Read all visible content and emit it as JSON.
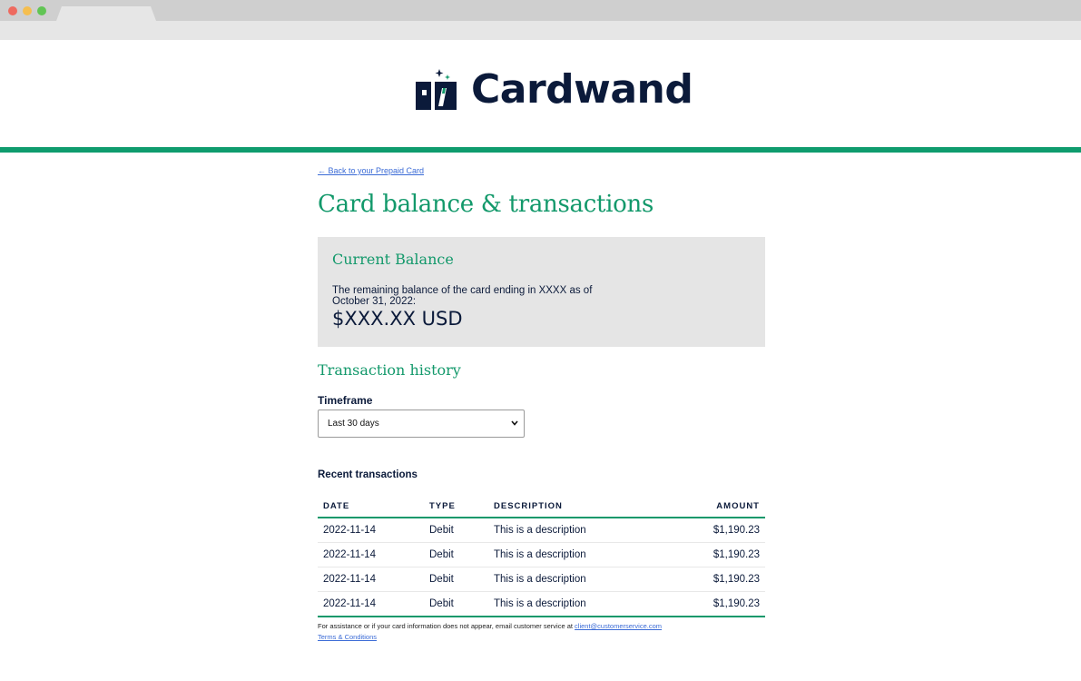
{
  "brand": {
    "name": "Cardwand",
    "colors": {
      "primary_green": "#13996b",
      "navy": "#0b1a3a",
      "link": "#3b6bd6",
      "card_bg": "#e5e5e5"
    }
  },
  "nav": {
    "back_link": "← Back to your Prepaid Card"
  },
  "page": {
    "title": "Card balance & transactions"
  },
  "balance": {
    "heading": "Current Balance",
    "description": "The remaining balance of the card ending in XXXX as of October 31, 2022:",
    "amount": "$XXX.XX USD"
  },
  "history": {
    "heading": "Transaction history",
    "timeframe_label": "Timeframe",
    "timeframe_selected": "Last 30 days",
    "recent_label": "Recent transactions",
    "columns": {
      "date": "DATE",
      "type": "TYPE",
      "description": "DESCRIPTION",
      "amount": "AMOUNT"
    },
    "rows": [
      {
        "date": "2022-11-14",
        "type": "Debit",
        "description": "This is a description",
        "amount": "$1,190.23"
      },
      {
        "date": "2022-11-14",
        "type": "Debit",
        "description": "This is a description",
        "amount": "$1,190.23"
      },
      {
        "date": "2022-11-14",
        "type": "Debit",
        "description": "This is a description",
        "amount": "$1,190.23"
      },
      {
        "date": "2022-11-14",
        "type": "Debit",
        "description": "This is a description",
        "amount": "$1,190.23"
      }
    ]
  },
  "footer": {
    "assistance_text": "For assistance or if your card information does not appear, email customer service at ",
    "email": "client@customerservice.com",
    "terms_link": "Terms & Conditions"
  },
  "icons": {
    "logo_mark": "card-wand-icon",
    "dropdown": "chevron-down-icon"
  }
}
